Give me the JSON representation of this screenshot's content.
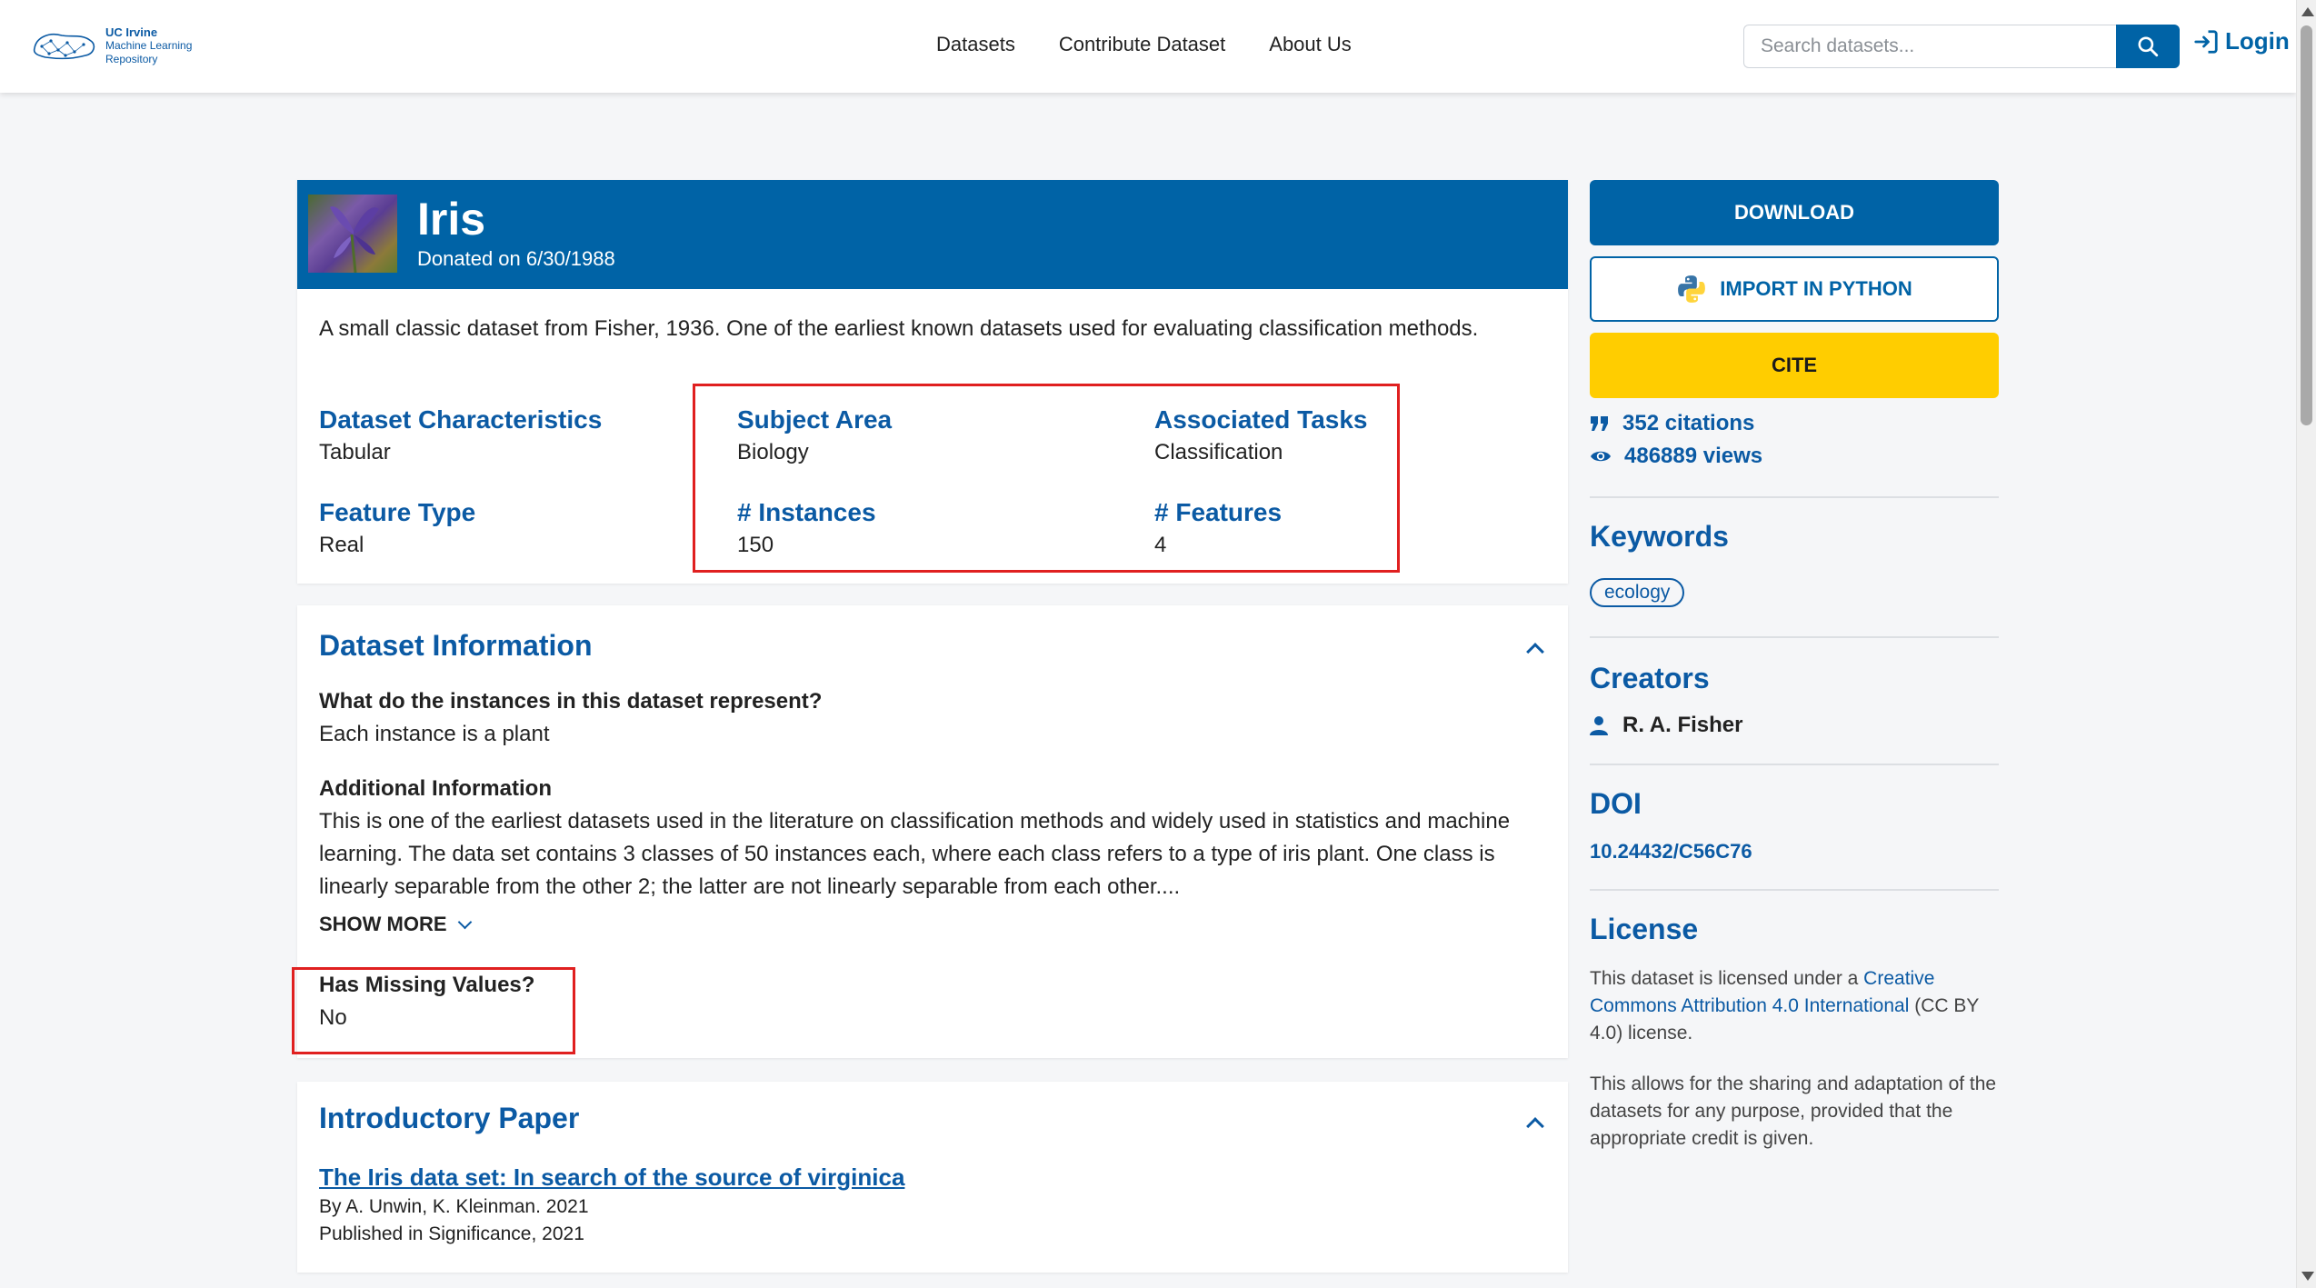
{
  "nav": {
    "logo_line1": "UC Irvine",
    "logo_line2": "Machine Learning",
    "logo_line3": "Repository",
    "links": [
      "Datasets",
      "Contribute Dataset",
      "About Us"
    ],
    "search_placeholder": "Search datasets...",
    "login_label": "Login"
  },
  "dataset": {
    "title": "Iris",
    "donated": "Donated on 6/30/1988",
    "description": "A small classic dataset from Fisher, 1936. One of the earliest known datasets used for evaluating classification methods.",
    "characteristics": [
      {
        "label": "Dataset Characteristics",
        "value": "Tabular"
      },
      {
        "label": "Subject Area",
        "value": "Biology"
      },
      {
        "label": "Associated Tasks",
        "value": "Classification"
      },
      {
        "label": "Feature Type",
        "value": "Real"
      },
      {
        "label": "# Instances",
        "value": "150"
      },
      {
        "label": "# Features",
        "value": "4"
      }
    ]
  },
  "info": {
    "title": "Dataset Information",
    "q1": "What do the instances in this dataset represent?",
    "a1": "Each instance is a plant",
    "q2": "Additional Information",
    "a2": "This is one of the earliest datasets used in the literature on classification methods and widely used in statistics and machine learning.  The data set contains 3 classes of 50 instances each, where each class refers to a type of iris plant. One class is linearly separable from the other 2; the latter are not linearly separable from each other....",
    "show_more": "SHOW MORE",
    "q3": "Has Missing Values?",
    "a3": "No"
  },
  "paper": {
    "title": "Introductory Paper",
    "link": "The Iris data set: In search of the source of virginica",
    "authors": "By A. Unwin, K. Kleinman. 2021",
    "published": "Published in Significance, 2021"
  },
  "sidebar": {
    "download": "DOWNLOAD",
    "import_python": "IMPORT IN PYTHON",
    "cite": "CITE",
    "citations": "352 citations",
    "views": "486889 views",
    "keywords_title": "Keywords",
    "keyword": "ecology",
    "creators_title": "Creators",
    "creator": "R. A. Fisher",
    "doi_title": "DOI",
    "doi": "10.24432/C56C76",
    "license_title": "License",
    "license_p1_pre": "This dataset is licensed under a ",
    "license_link": "Creative Commons Attribution 4.0 International",
    "license_p1_post": " (CC BY 4.0) license.",
    "license_p2": "This allows for the sharing and adaptation of the datasets for any purpose, provided that the appropriate credit is given."
  },
  "colors": {
    "brand_blue": "#0063a6",
    "cite_yellow": "#ffcd00",
    "highlight_red": "#e02020"
  }
}
